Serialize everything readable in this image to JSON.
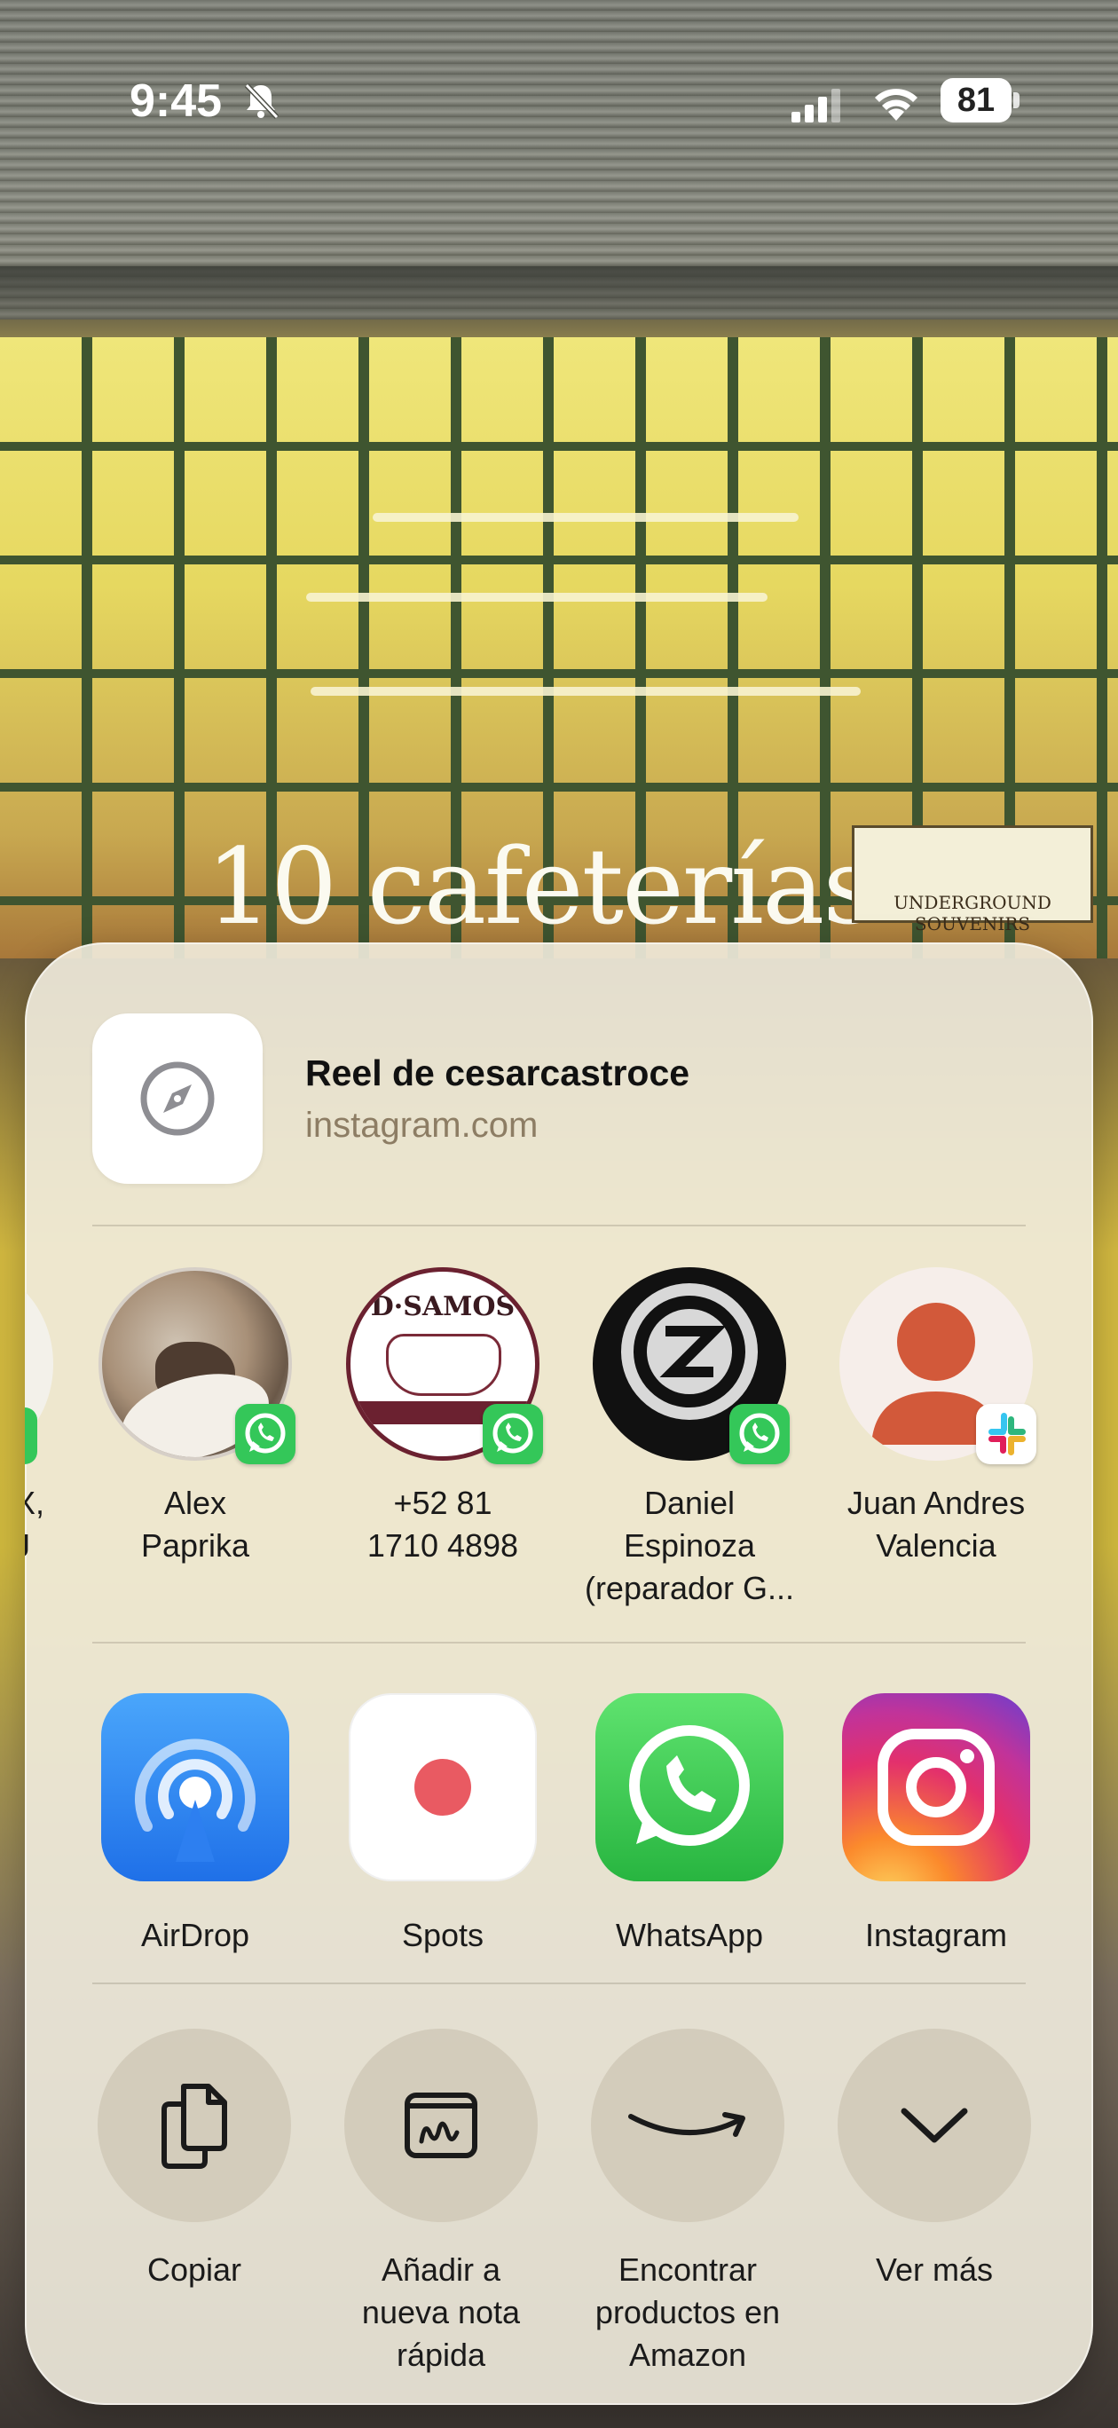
{
  "status_bar": {
    "time": "9:45",
    "battery": "81",
    "icons": [
      "bell-slash-icon",
      "cellular-signal-icon",
      "wifi-icon",
      "battery-icon"
    ]
  },
  "background": {
    "sign_text": "10 cafeterías",
    "store_sign": "UNDERGROUND SOUVENIRS"
  },
  "share_sheet": {
    "header": {
      "title": "Reel de cesarcastroce",
      "url": "instagram.com",
      "icon": "safari-compass-icon"
    },
    "contacts": [
      {
        "line1": "Alex",
        "line2": "Paprika",
        "line3": "",
        "app_badge": "whatsapp"
      },
      {
        "line1": "+52 81",
        "line2": "1710 4898",
        "line3": "",
        "app_badge": "whatsapp"
      },
      {
        "line1": "Daniel",
        "line2": "Espinoza",
        "line3": "(reparador G...",
        "app_badge": "whatsapp"
      },
      {
        "line1": "Juan Andres",
        "line2": "Valencia",
        "line3": "",
        "app_badge": "slack"
      }
    ],
    "partial_contact_text": "X,\nJ",
    "apps": [
      {
        "label": "AirDrop",
        "icon": "airdrop-icon"
      },
      {
        "label": "Spots",
        "icon": "spots-icon"
      },
      {
        "label": "WhatsApp",
        "icon": "whatsapp-icon"
      },
      {
        "label": "Instagram",
        "icon": "instagram-icon"
      }
    ],
    "actions": [
      {
        "line1": "Copiar",
        "line2": "",
        "line3": "",
        "icon": "copy-icon"
      },
      {
        "line1": "Añadir a",
        "line2": "nueva nota",
        "line3": "rápida",
        "icon": "quick-note-icon"
      },
      {
        "line1": "Encontrar",
        "line2": "productos en",
        "line3": "Amazon",
        "icon": "amazon-icon"
      },
      {
        "line1": "Ver más",
        "line2": "",
        "line3": "",
        "icon": "chevron-down-icon"
      }
    ]
  },
  "colors": {
    "whatsapp": "#34c759",
    "airdrop": "#2f86f6",
    "spots_dot": "#e95a62",
    "url_text": "#8d7d64"
  }
}
